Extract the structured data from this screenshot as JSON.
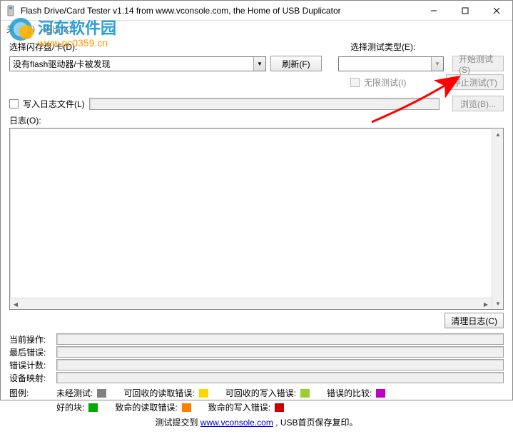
{
  "window": {
    "title": "Flash Drive/Card Tester v1.14 from www.vconsole.com, the Home of USB Duplicator"
  },
  "menubar": {
    "item1": "关于(A)",
    "item2": "退出(X)"
  },
  "watermark": {
    "text1": "河东软件园",
    "url": "www.pc0359.cn"
  },
  "sel_drive_label": "选择闪存盘/卡(D):",
  "sel_drive_value": "没有flash驱动器/卡被发现",
  "refresh_btn": "刷新(F)",
  "sel_type_label": "选择测试类型(E):",
  "unlimited_test": "无限测试(I)",
  "start_test": "开始测试(S)",
  "stop_test": "停止测试(T)",
  "write_log": "写入日志文件(L)",
  "browse_btn": "浏览(B)...",
  "log_label": "日志(O):",
  "clear_log": "清理日志(C)",
  "status": {
    "current_op": "当前操作:",
    "last_error": "最后错误:",
    "error_count": "错误计数:",
    "device_map": "设备映射:"
  },
  "legend": {
    "label": "图例:",
    "untested": "未经测试:",
    "rec_read": "可回收的读取错误:",
    "rec_write": "可回收的写入错误:",
    "bad_compare": "错误的比较:",
    "good": "好的块:",
    "fatal_read": "致命的读取错误:",
    "fatal_write": "致命的写入错误:"
  },
  "footer": {
    "submit_prefix": "测试提交到 ",
    "link": "www.vconsole.com",
    "suffix": " , USB首页保存复印。"
  }
}
